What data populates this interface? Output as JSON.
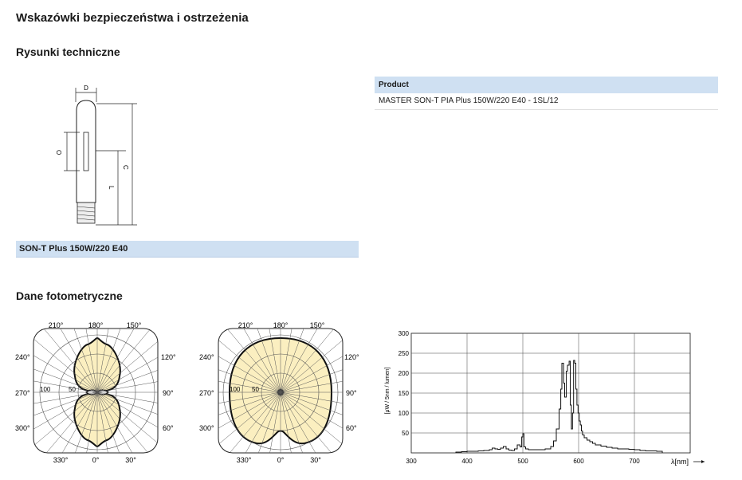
{
  "page": {
    "title": "Wskazówki bezpieczeństwa i ostrzeżenia",
    "section_drawings": "Rysunki techniczne",
    "section_photometric": "Dane fotometryczne"
  },
  "drawing": {
    "dim_d": "D",
    "dim_o": "O",
    "dim_c": "C",
    "dim_l": "L",
    "spec_label": "SON-T Plus 150W/220 E40"
  },
  "product_table": {
    "header": "Product",
    "rows": [
      "MASTER SON-T PIA Plus 150W/220 E40 - 1SL/12"
    ]
  },
  "polar_labels": {
    "angles_top": [
      "210°",
      "180°",
      "150°"
    ],
    "angles_left": [
      "240°",
      "270°",
      "300°"
    ],
    "angles_right": [
      "120°",
      "90°",
      "60°"
    ],
    "angles_bottom": [
      "330°",
      "0°",
      "30°"
    ],
    "radial": [
      "100",
      "50"
    ]
  },
  "colors": {
    "band": "#cfe0f2",
    "photometric_fill": "#fbefc0"
  },
  "chart_data": {
    "type": "line",
    "title": "",
    "xlabel": "λ[nm]",
    "ylabel": "[μW / 5nm / lumen]",
    "xlim": [
      300,
      800
    ],
    "ylim": [
      0,
      300
    ],
    "xticks": [
      300,
      400,
      500,
      600,
      700
    ],
    "yticks": [
      50,
      100,
      150,
      200,
      250,
      300
    ],
    "grid": true,
    "series": [
      {
        "x": [
          380,
          390,
          400,
          410,
          420,
          430,
          440,
          445,
          450,
          455,
          460,
          465,
          470,
          475,
          480,
          485,
          490,
          495,
          498,
          500,
          502,
          505,
          510,
          520,
          530,
          540,
          550,
          555,
          560,
          565,
          568,
          570,
          573,
          575,
          578,
          580,
          583,
          585,
          587,
          589,
          591,
          593,
          595,
          597,
          599,
          601,
          603,
          605,
          607,
          610,
          615,
          620,
          625,
          630,
          640,
          650,
          660,
          670,
          680,
          690,
          700,
          710,
          720,
          730,
          740,
          750
        ],
        "values": [
          2,
          3,
          4,
          4,
          5,
          6,
          8,
          12,
          10,
          9,
          12,
          16,
          10,
          7,
          6,
          10,
          20,
          15,
          40,
          48,
          15,
          10,
          8,
          8,
          8,
          10,
          16,
          30,
          60,
          110,
          160,
          225,
          175,
          140,
          205,
          220,
          230,
          120,
          60,
          100,
          232,
          225,
          160,
          120,
          100,
          80,
          70,
          55,
          45,
          38,
          32,
          28,
          24,
          20,
          17,
          14,
          12,
          10,
          10,
          9,
          8,
          6,
          5,
          5,
          4,
          4
        ]
      }
    ]
  }
}
